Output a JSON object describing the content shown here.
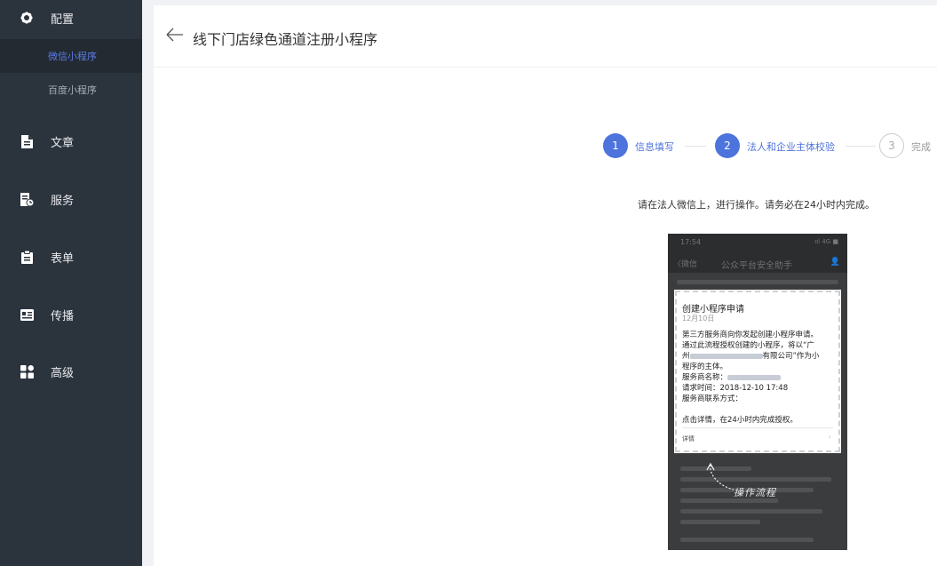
{
  "sidebar": {
    "items": [
      {
        "icon": "gear-icon",
        "label": "配置"
      },
      {
        "icon": "document-icon",
        "label": "文章"
      },
      {
        "icon": "service-icon",
        "label": "服务"
      },
      {
        "icon": "clipboard-icon",
        "label": "表单"
      },
      {
        "icon": "broadcast-icon",
        "label": "传播"
      },
      {
        "icon": "grid-icon",
        "label": "高级"
      }
    ],
    "sub_items": [
      {
        "label": "微信小程序",
        "active": true
      },
      {
        "label": "百度小程序",
        "active": false
      }
    ]
  },
  "header": {
    "title": "线下门店绿色通道注册小程序"
  },
  "steps": [
    {
      "num": "1",
      "label": "信息填写",
      "state": "done"
    },
    {
      "num": "2",
      "label": "法人和企业主体校验",
      "state": "done"
    },
    {
      "num": "3",
      "label": "完成",
      "state": "todo"
    }
  ],
  "instruction": "请在法人微信上，进行操作。请务必在24小时内完成。",
  "phone": {
    "time": "17:54",
    "signal": "ııl 4G ■",
    "nav_back": "〈微信",
    "nav_title": "公众平台安全助手",
    "card_title": "创建小程序申请",
    "card_date": "12月10日",
    "body_line1": "第三方服务商向你发起创建小程序申请。",
    "body_line2": "通过此流程授权创建的小程序，将以“广",
    "body_line3_prefix": "州",
    "body_line3_suffix": "有限公司”作为小",
    "body_line4": "程序的主体。",
    "body_line5": "服务商名称：",
    "body_line6": "请求时间：2018-12-10 17:48",
    "body_line7": "服务商联系方式：",
    "body_line8": "点击详情，在24小时内完成授权。",
    "detail_label": "详情",
    "hint": "操作流程"
  }
}
